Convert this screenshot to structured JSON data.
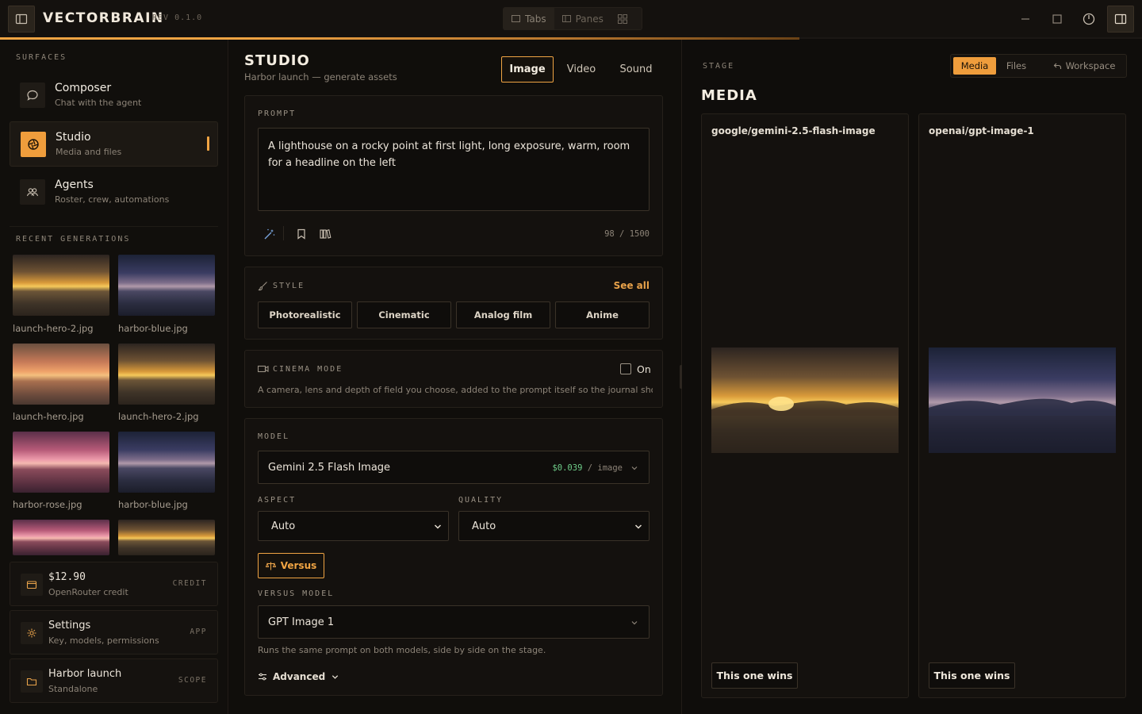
{
  "app": {
    "brand": "VECTORBRAIN",
    "rev": "REV 0.1.0",
    "view_switch": [
      "Tabs",
      "Panes"
    ],
    "progress": 0.7
  },
  "sidebar": {
    "surfaces_label": "SURFACES",
    "items": [
      {
        "title": "Composer",
        "subtitle": "Chat with the agent"
      },
      {
        "title": "Studio",
        "subtitle": "Media and files"
      },
      {
        "title": "Agents",
        "subtitle": "Roster, crew, automations"
      }
    ],
    "recent_label": "RECENT GENERATIONS",
    "recent": [
      {
        "name": "launch-hero-2.jpg",
        "tone": "warm"
      },
      {
        "name": "harbor-blue.jpg",
        "tone": "blue"
      },
      {
        "name": "launch-hero.jpg",
        "tone": "dusk"
      },
      {
        "name": "launch-hero-2.jpg",
        "tone": "warm"
      },
      {
        "name": "harbor-rose.jpg",
        "tone": "rose"
      },
      {
        "name": "harbor-blue.jpg",
        "tone": "blue"
      }
    ],
    "cards": [
      {
        "title": "$12.90",
        "subtitle": "OpenRouter credit",
        "tag": "CREDIT"
      },
      {
        "title": "Settings",
        "subtitle": "Key, models, permissions",
        "tag": "APP"
      },
      {
        "title": "Harbor launch",
        "subtitle": "Standalone",
        "tag": "SCOPE"
      }
    ]
  },
  "studio": {
    "title": "STUDIO",
    "subtitle": "Harbor launch — generate assets",
    "tabs": [
      "Image",
      "Video",
      "Sound"
    ],
    "prompt": {
      "label": "PROMPT",
      "value": "A lighthouse on a rocky point at first light, long exposure, warm, room for a headline on the left",
      "count": "98",
      "max": "1500"
    },
    "style": {
      "label": "STYLE",
      "see_all": "See all",
      "options": [
        "Photorealistic",
        "Cinematic",
        "Analog film",
        "Anime"
      ]
    },
    "cinema": {
      "label": "CINEMA MODE",
      "toggle_label": "On",
      "description": "A camera, lens and depth of field you choose, added to the prompt itself so the journal shows..."
    },
    "model": {
      "label": "MODEL",
      "value": "Gemini 2.5 Flash Image",
      "price": "$0.039",
      "unit": "image",
      "aspect_label": "ASPECT",
      "aspect_value": "Auto",
      "quality_label": "QUALITY",
      "quality_value": "Auto",
      "versus_button": "Versus",
      "versus_label": "VERSUS MODEL",
      "versus_value": "GPT Image 1",
      "versus_note": "Runs the same prompt on both models, side by side on the stage.",
      "advanced": "Advanced"
    }
  },
  "stage": {
    "label": "STAGE",
    "title": "MEDIA",
    "switch": [
      "Media",
      "Files",
      "Workspace"
    ],
    "cards": [
      {
        "model": "google/gemini-2.5-flash-image",
        "button": "This one wins",
        "tone": "warm"
      },
      {
        "model": "openai/gpt-image-1",
        "button": "This one wins",
        "tone": "blue"
      }
    ]
  },
  "colors": {
    "accent": "#f0a443",
    "background": "#0e0c0a",
    "price": "#6fcf8a"
  }
}
